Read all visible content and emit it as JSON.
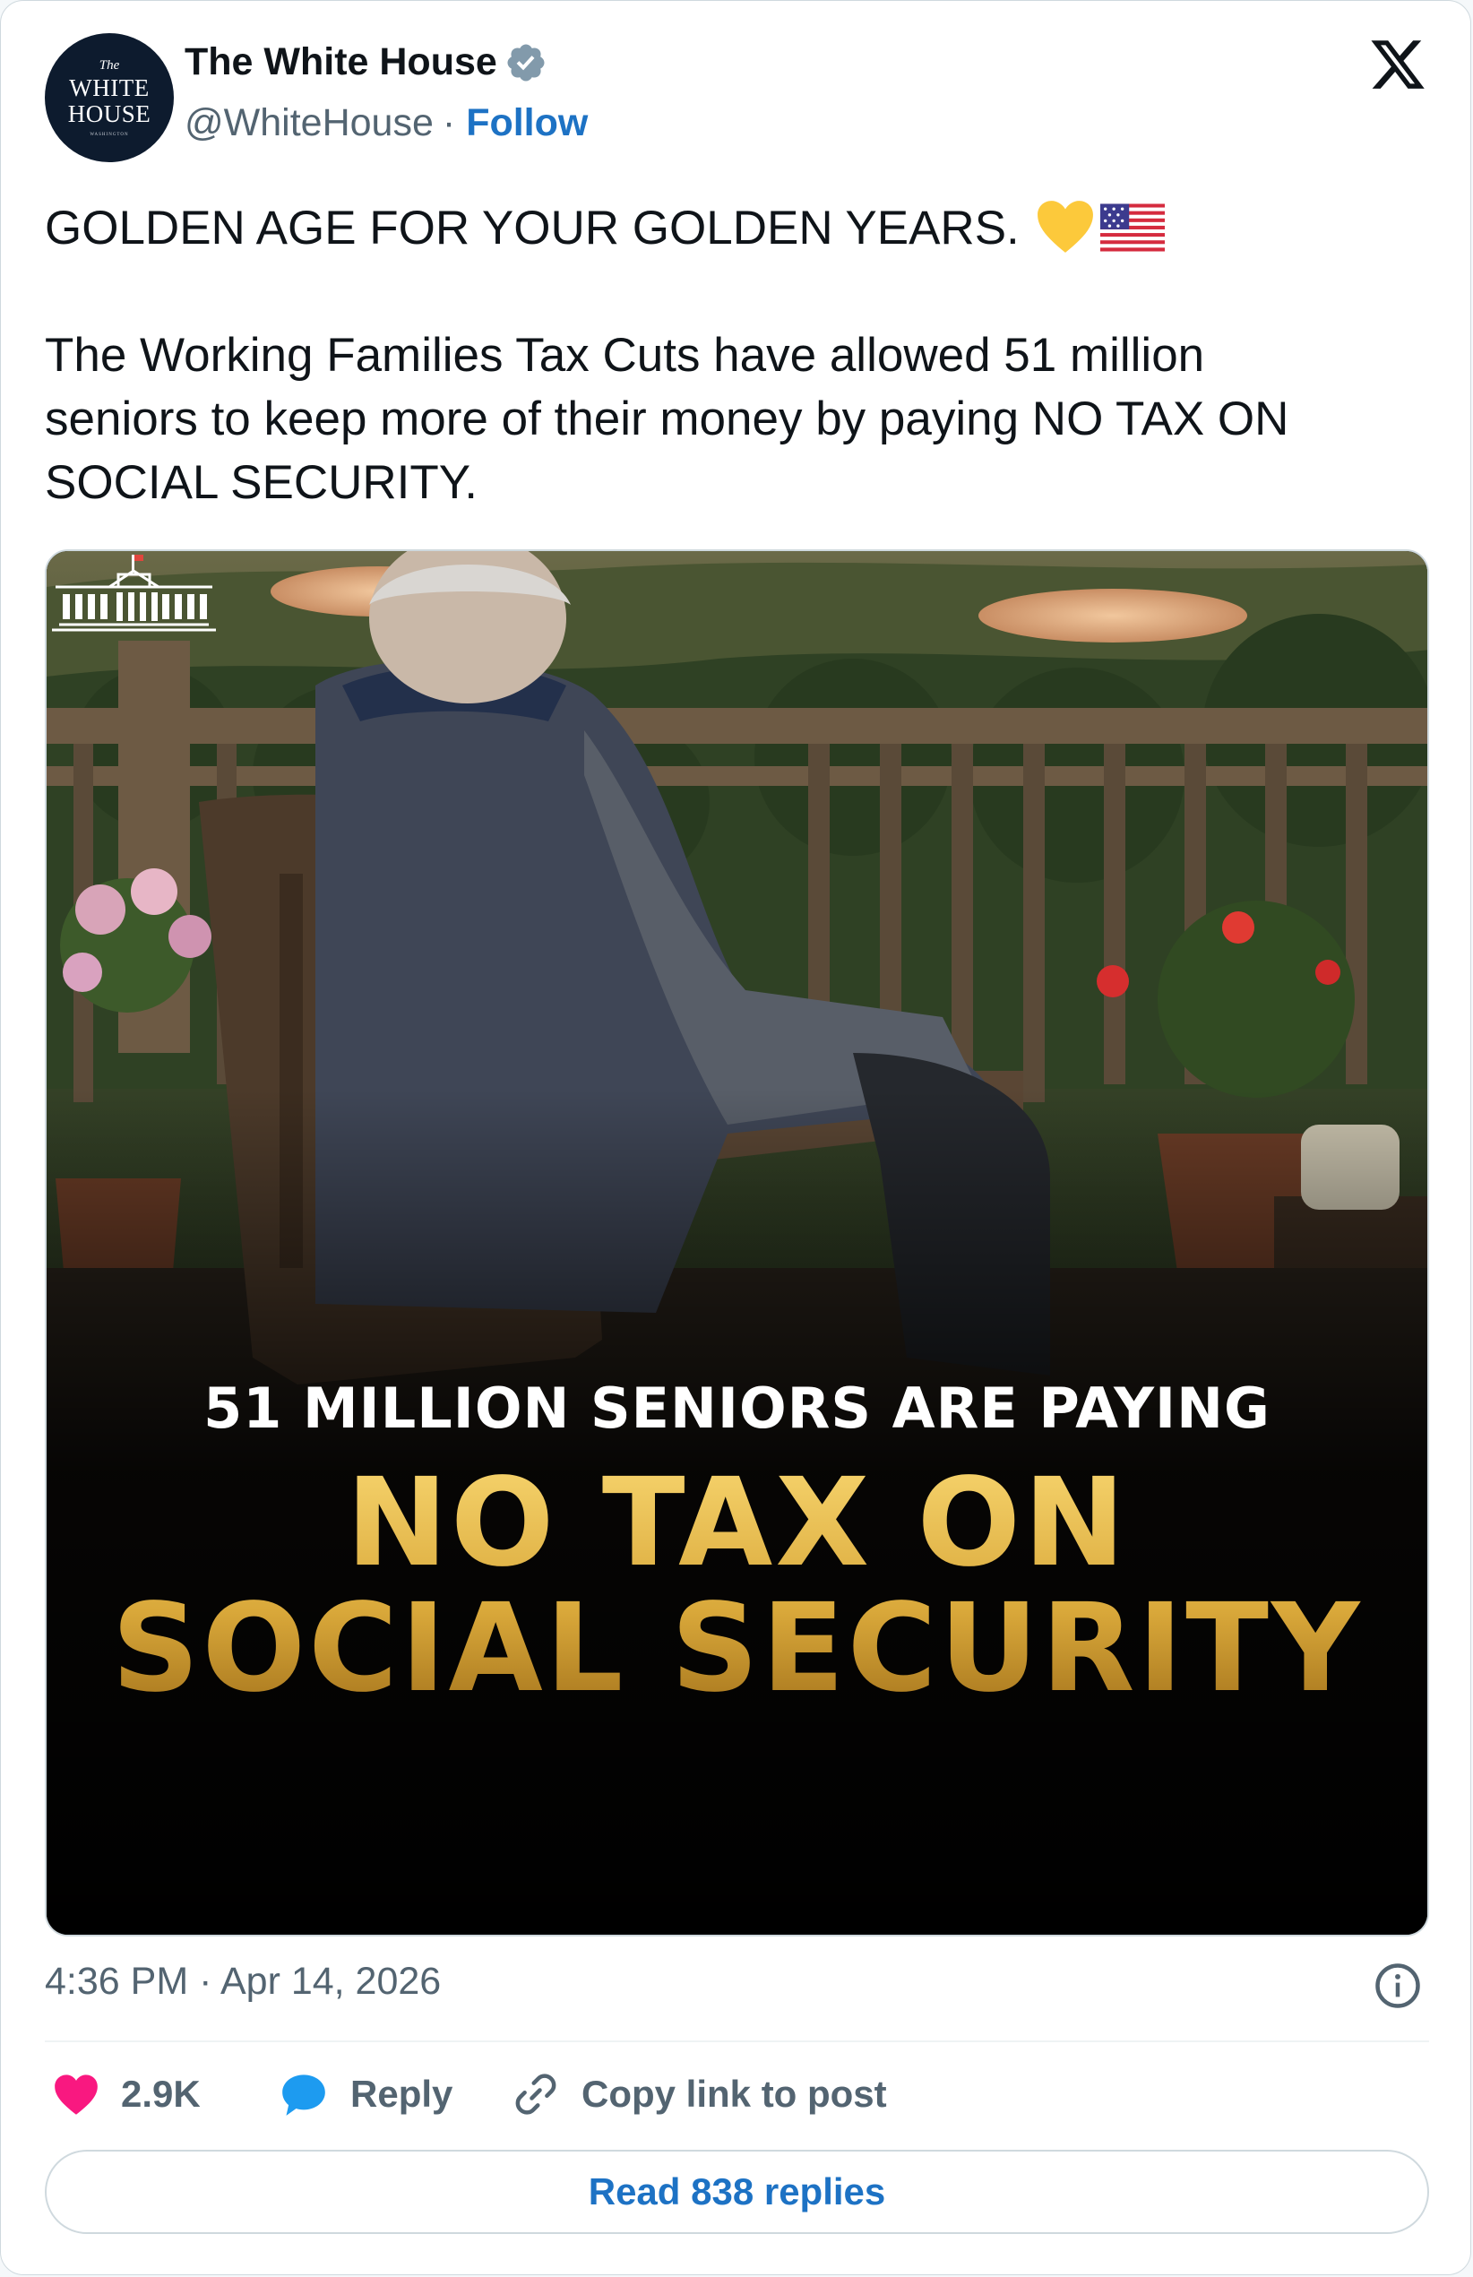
{
  "author": {
    "name": "The White House",
    "handle": "@WhiteHouse",
    "separator": "·",
    "follow_label": "Follow",
    "verified": true,
    "avatar_text": {
      "line1": "The",
      "line2": "WHITE",
      "line3": "HOUSE",
      "line4": "WASHINGTON"
    }
  },
  "post": {
    "line1": "GOLDEN AGE FOR YOUR GOLDEN YEARS.",
    "emojis": [
      "yellow-heart",
      "us-flag"
    ],
    "body_lines": [
      "The Working Families Tax Cuts have allowed 51 million",
      "seniors to keep more of their money by paying NO TAX ON",
      "SOCIAL SECURITY."
    ]
  },
  "media": {
    "headline_small": "51 MILLION SENIORS ARE PAYING",
    "headline_big_1": "NO TAX ON",
    "headline_big_2": "SOCIAL SECURITY",
    "logo": "white-house-building-logo"
  },
  "timestamp": "4:36 PM · Apr 14, 2026",
  "actions": {
    "like_count": "2.9K",
    "reply_label": "Reply",
    "copy_link_label": "Copy link to post"
  },
  "read_replies_label": "Read 838 replies",
  "colors": {
    "link_blue": "#1d72c4",
    "like_pink": "#f91880",
    "reply_blue": "#1d9bf0",
    "gold": "#e2b14a"
  }
}
